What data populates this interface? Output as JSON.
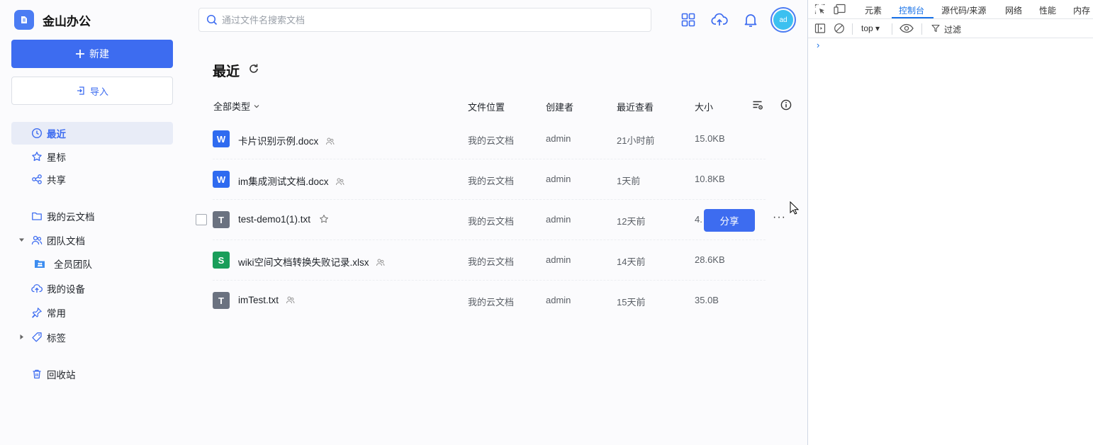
{
  "app": {
    "title": "金山办公",
    "brand_color": "#3d6cf0"
  },
  "sidebar": {
    "new_label": "新建",
    "import_label": "导入",
    "items": [
      {
        "label": "最近",
        "icon": "clock-icon",
        "active": true
      },
      {
        "label": "星标",
        "icon": "star-icon"
      },
      {
        "label": "共享",
        "icon": "share-icon"
      },
      {
        "label": "我的云文档",
        "icon": "folder-icon"
      },
      {
        "label": "团队文档",
        "icon": "team-icon",
        "expanded": true
      },
      {
        "label": "全员团队",
        "icon": "team-folder-icon"
      },
      {
        "label": "我的设备",
        "icon": "cloud-upload-icon"
      },
      {
        "label": "常用",
        "icon": "pin-icon"
      },
      {
        "label": "标签",
        "icon": "tag-icon",
        "expanded": false
      },
      {
        "label": "回收站",
        "icon": "trash-icon"
      }
    ]
  },
  "header": {
    "search_placeholder": "通过文件名搜索文档",
    "avatar_text": "ad"
  },
  "main": {
    "title": "最近",
    "type_filter": "全部类型",
    "columns": {
      "location": "文件位置",
      "creator": "创建者",
      "viewed": "最近查看",
      "size": "大小"
    },
    "share_label": "分享",
    "more_label": "···",
    "files": [
      {
        "name": "卡片识别示例.docx",
        "type": "W",
        "color": "#2f6bf0",
        "location": "我的云文档",
        "creator": "admin",
        "viewed": "21小时前",
        "size": "15.0KB"
      },
      {
        "name": "im集成测试文档.docx",
        "type": "W",
        "color": "#2f6bf0",
        "location": "我的云文档",
        "creator": "admin",
        "viewed": "1天前",
        "size": "10.8KB"
      },
      {
        "name": "test-demo1(1).txt",
        "type": "T",
        "color": "#6b7280",
        "location": "我的云文档",
        "creator": "admin",
        "viewed": "12天前",
        "size": "4.",
        "hovered": true
      },
      {
        "name": "wiki空间文档转换失败记录.xlsx",
        "type": "S",
        "color": "#1a9e5a",
        "location": "我的云文档",
        "creator": "admin",
        "viewed": "14天前",
        "size": "28.6KB"
      },
      {
        "name": "imTest.txt",
        "type": "T",
        "color": "#6b7280",
        "location": "我的云文档",
        "creator": "admin",
        "viewed": "15天前",
        "size": "35.0B"
      }
    ]
  },
  "devtools": {
    "tabs": [
      "元素",
      "控制台",
      "源代码/来源",
      "网络",
      "性能",
      "内存"
    ],
    "active_tab": "控制台",
    "context": "top ▾",
    "filter_label": "过滤",
    "prompt": "›"
  }
}
